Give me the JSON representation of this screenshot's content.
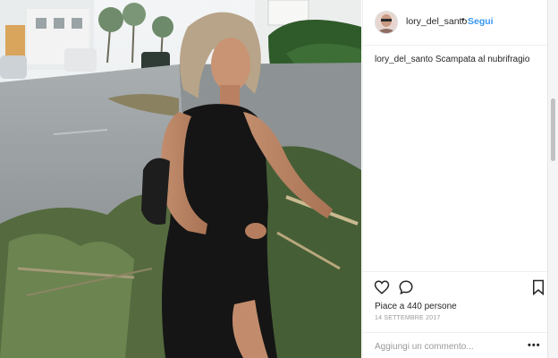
{
  "post": {
    "username": "lory_del_santo",
    "separator": "•",
    "follow_label": "Segui",
    "caption_username": "lory_del_santo",
    "caption_text": "Scampata al nubrifragio",
    "likes_text": "Piace a 440 persone",
    "date_text": "14 SETTEMBRE 2017",
    "comment_placeholder": "Aggiungi un commento...",
    "more_label": "•••"
  },
  "icons": {
    "like": "heart-icon",
    "comment": "comment-icon",
    "save": "bookmark-icon"
  },
  "colors": {
    "link_blue": "#3897f0",
    "text": "#262626",
    "muted": "#999999",
    "border": "#efefef"
  }
}
